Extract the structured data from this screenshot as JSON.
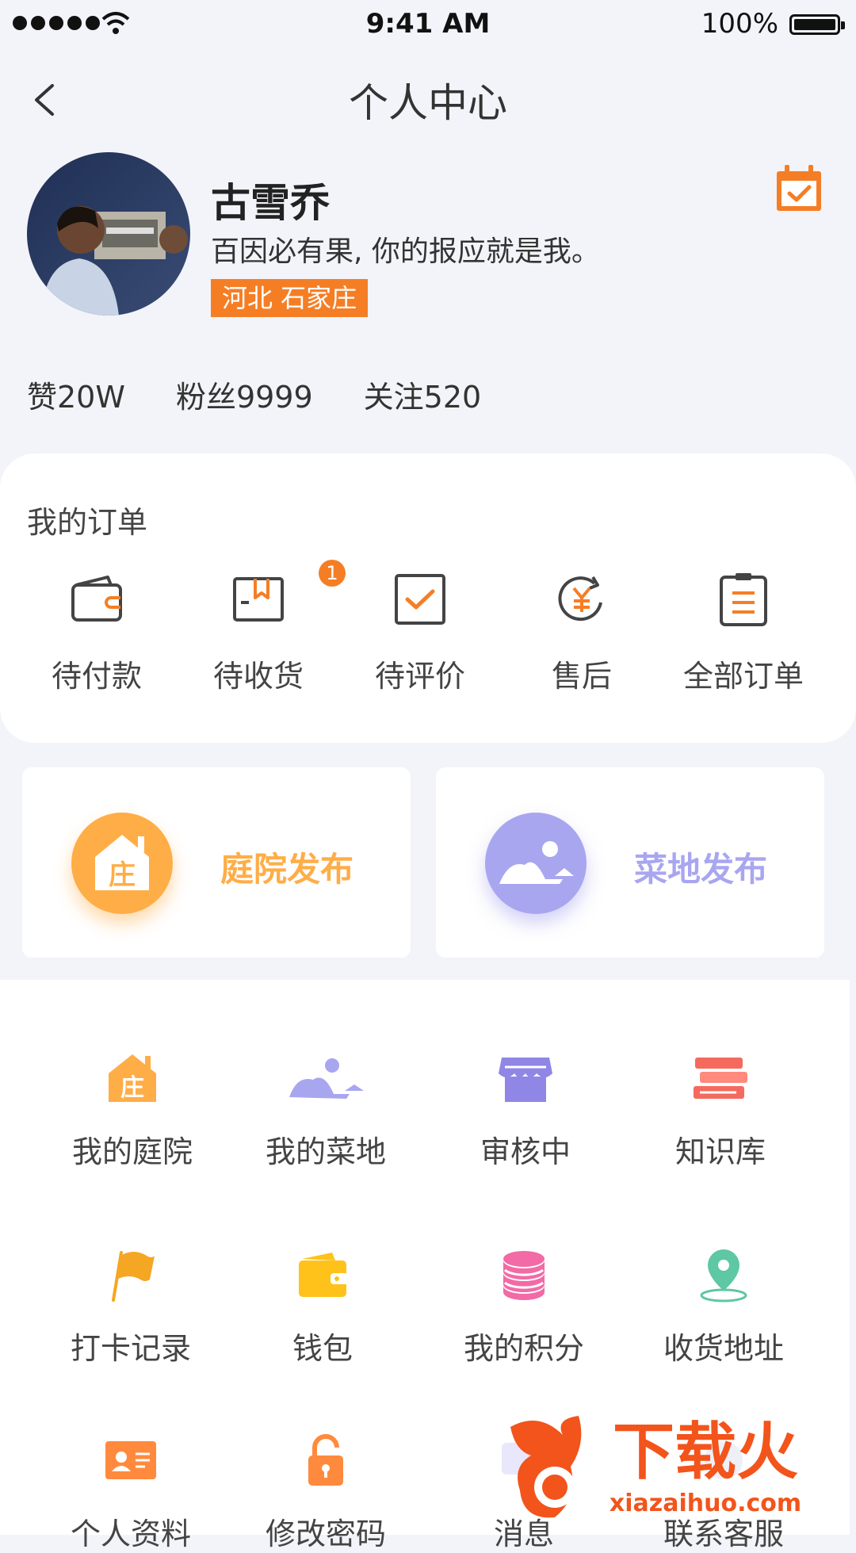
{
  "status_bar": {
    "time": "9:41 AM",
    "battery": "100%"
  },
  "header": {
    "title": "个人中心"
  },
  "profile": {
    "name": "古雪乔",
    "motto": "百因必有果, 你的报应就是我。",
    "location": "河北   石家庄"
  },
  "stats": {
    "likes": "赞20W",
    "fans": "粉丝9999",
    "following": "关注520"
  },
  "orders": {
    "title": "我的订单",
    "items": [
      {
        "label": "待付款",
        "icon": "wallet-icon"
      },
      {
        "label": "待收货",
        "icon": "package-icon",
        "badge": "1"
      },
      {
        "label": "待评价",
        "icon": "checkbox-icon"
      },
      {
        "label": "售后",
        "icon": "refund-icon"
      },
      {
        "label": "全部订单",
        "icon": "clipboard-icon"
      }
    ]
  },
  "publish": {
    "courtyard": {
      "label": "庭院发布",
      "icon_char": "庄",
      "color": "#ffad47"
    },
    "garden": {
      "label": "菜地发布",
      "color": "#a9a6f0"
    }
  },
  "menu": [
    {
      "label": "我的庭院",
      "icon": "courtyard-icon",
      "icon_char": "庄"
    },
    {
      "label": "我的菜地",
      "icon": "garden-icon"
    },
    {
      "label": "审核中",
      "icon": "shop-icon"
    },
    {
      "label": "知识库",
      "icon": "books-icon"
    },
    {
      "label": "打卡记录",
      "icon": "flag-icon"
    },
    {
      "label": "钱包",
      "icon": "wallet-icon"
    },
    {
      "label": "我的积分",
      "icon": "coins-icon"
    },
    {
      "label": "收货地址",
      "icon": "location-icon"
    },
    {
      "label": "个人资料",
      "icon": "id-card-icon"
    },
    {
      "label": "修改密码",
      "icon": "lock-icon"
    },
    {
      "label": "消息",
      "icon": "message-icon"
    },
    {
      "label": "联系客服",
      "icon": "service-icon"
    }
  ],
  "watermark": {
    "brand": "下载火",
    "url": "xiazaihuo.com"
  },
  "colors": {
    "accent": "#f57e25",
    "orange": "#ffad47",
    "purple": "#a9a6f0",
    "background": "#f3f4f9"
  }
}
